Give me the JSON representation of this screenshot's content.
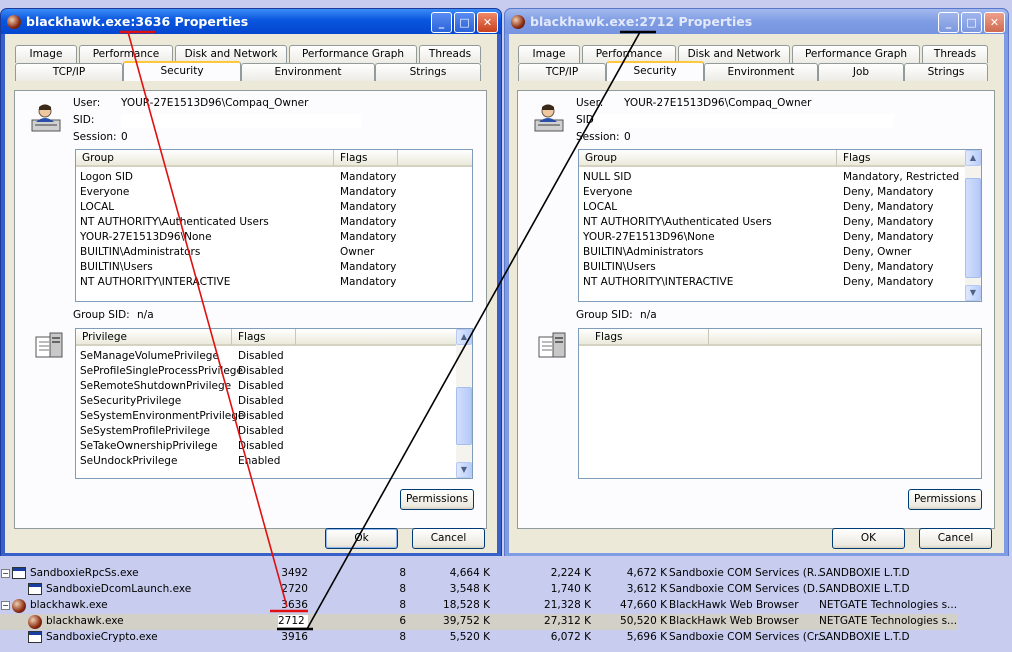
{
  "windows": [
    {
      "title_prefix": "blackhawk.exe:",
      "pid": "3636",
      "title_suffix": " Properties",
      "tabs_row1": [
        "Image",
        "Performance",
        "Disk and Network",
        "Performance Graph",
        "Threads"
      ],
      "tabs_row2": [
        "TCP/IP",
        "Security",
        "Environment",
        "Strings"
      ],
      "user_label": "User:",
      "user_value": "YOUR-27E1513D96\\Compaq_Owner",
      "sid_label": "SID:",
      "session_label": "Session:",
      "session_value": "0",
      "groups_header": [
        "Group",
        "Flags"
      ],
      "groups": [
        [
          "Logon SID",
          "Mandatory"
        ],
        [
          "Everyone",
          "Mandatory"
        ],
        [
          "LOCAL",
          "Mandatory"
        ],
        [
          "NT AUTHORITY\\Authenticated Users",
          "Mandatory"
        ],
        [
          "YOUR-27E1513D96\\None",
          "Mandatory"
        ],
        [
          "BUILTIN\\Administrators",
          "Owner"
        ],
        [
          "BUILTIN\\Users",
          "Mandatory"
        ],
        [
          "NT AUTHORITY\\INTERACTIVE",
          "Mandatory"
        ]
      ],
      "group_sid_label": "Group SID:",
      "group_sid_value": "n/a",
      "priv_header": [
        "Privilege",
        "Flags"
      ],
      "privileges": [
        [
          "SeManageVolumePrivilege",
          "Disabled"
        ],
        [
          "SeProfileSingleProcessPrivilege",
          "Disabled"
        ],
        [
          "SeRemoteShutdownPrivilege",
          "Disabled"
        ],
        [
          "SeSecurityPrivilege",
          "Disabled"
        ],
        [
          "SeSystemEnvironmentPrivilege",
          "Disabled"
        ],
        [
          "SeSystemProfilePrivilege",
          "Disabled"
        ],
        [
          "SeTakeOwnershipPrivilege",
          "Disabled"
        ],
        [
          "SeUndockPrivilege",
          "Enabled"
        ]
      ],
      "permissions_label": "Permissions",
      "ok_label": "Ok",
      "cancel_label": "Cancel"
    },
    {
      "title_prefix": "blackhawk.exe:",
      "pid": "2712",
      "title_suffix": " Properties",
      "tabs_row1": [
        "Image",
        "Performance",
        "Disk and Network",
        "Performance Graph",
        "Threads"
      ],
      "tabs_row2": [
        "TCP/IP",
        "Security",
        "Environment",
        "Job",
        "Strings"
      ],
      "user_label": "User:",
      "user_value": "YOUR-27E1513D96\\Compaq_Owner",
      "sid_label": "SID:",
      "session_label": "Session:",
      "session_value": "0",
      "groups_header": [
        "Group",
        "Flags"
      ],
      "groups": [
        [
          "NULL SID",
          "Mandatory, Restricted"
        ],
        [
          "Everyone",
          "Deny, Mandatory"
        ],
        [
          "LOCAL",
          "Deny, Mandatory"
        ],
        [
          "NT AUTHORITY\\Authenticated Users",
          "Deny, Mandatory"
        ],
        [
          "YOUR-27E1513D96\\None",
          "Deny, Mandatory"
        ],
        [
          "BUILTIN\\Administrators",
          "Deny, Owner"
        ],
        [
          "BUILTIN\\Users",
          "Deny, Mandatory"
        ],
        [
          "NT AUTHORITY\\INTERACTIVE",
          "Deny, Mandatory"
        ]
      ],
      "group_sid_label": "Group SID:",
      "group_sid_value": "n/a",
      "priv_header": [
        "Flags"
      ],
      "privileges": [],
      "permissions_label": "Permissions",
      "ok_label": "OK",
      "cancel_label": "Cancel"
    }
  ],
  "processes": [
    {
      "name": "SandboxieRpcSs.exe",
      "pid": "3492",
      "threads": "8",
      "private": "4,664 K",
      "working": "2,224 K",
      "virtual": "4,672 K",
      "desc": "Sandboxie COM Services (R...",
      "company": "SANDBOXIE L.T.D",
      "icon": "window-icon",
      "expand": "−"
    },
    {
      "name": "SandboxieDcomLaunch.exe",
      "pid": "2720",
      "threads": "8",
      "private": "3,548 K",
      "working": "1,740 K",
      "virtual": "3,612 K",
      "desc": "Sandboxie COM Services (D...",
      "company": "SANDBOXIE L.T.D",
      "icon": "window-icon",
      "expand": ""
    },
    {
      "name": "blackhawk.exe",
      "pid": "3636",
      "threads": "8",
      "private": "18,528 K",
      "working": "21,328 K",
      "virtual": "47,660 K",
      "desc": "BlackHawk Web Browser",
      "company": "NETGATE Technologies s...",
      "icon": "blackhawk-icon",
      "expand": "−"
    },
    {
      "name": "blackhawk.exe",
      "pid": "2712",
      "threads": "6",
      "private": "39,752 K",
      "working": "27,312 K",
      "virtual": "50,520 K",
      "desc": "BlackHawk Web Browser",
      "company": "NETGATE Technologies s...",
      "icon": "blackhawk-icon",
      "expand": ""
    },
    {
      "name": "SandboxieCrypto.exe",
      "pid": "3916",
      "threads": "8",
      "private": "5,520 K",
      "working": "6,072 K",
      "virtual": "5,696 K",
      "desc": "Sandboxie COM Services (Cr...",
      "company": "SANDBOXIE L.T.D",
      "icon": "window-icon",
      "expand": ""
    }
  ],
  "colors": {
    "annotation_red": "#e01010",
    "annotation_black": "#000000",
    "titlebar_active": "#0a55de",
    "titlebar_inactive": "#7e9ce4"
  }
}
